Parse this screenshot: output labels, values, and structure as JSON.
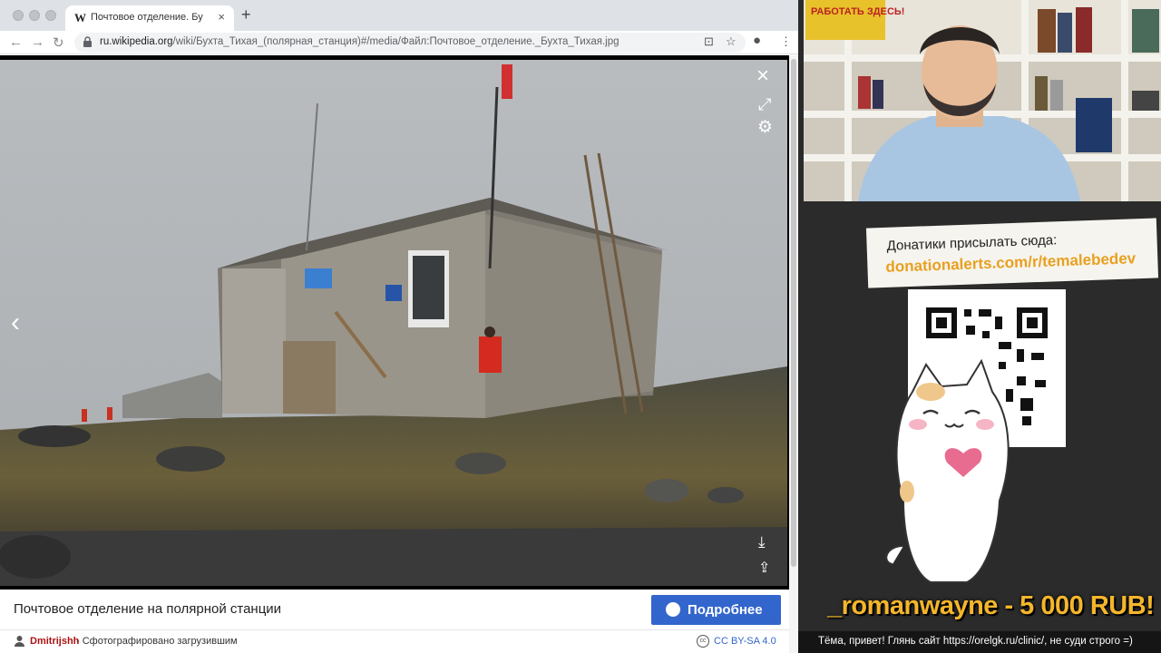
{
  "browser": {
    "tab_title": "Почтовое отделение. Бухта Т",
    "tab_favicon": "W",
    "url_host": "ru.wikipedia.org",
    "url_path": "/wiki/Бухта_Тихая_(полярная_станция)#/media/Файл:Почтовое_отделение._Бухта_Тихая.jpg"
  },
  "viewer": {
    "caption": "Почтовое отделение на полярной станции",
    "more_button": "Подробнее",
    "author": "Dmitrijshh",
    "author_desc": "- Сфотографировано загрузившим",
    "license": "CC BY-SA 4.0",
    "icons": [
      "close-icon",
      "fullscreen-icon",
      "settings-icon",
      "prev-arrow-icon",
      "download-icon",
      "share-icon"
    ]
  },
  "stream": {
    "poster_text": "РАБОТАТЬ ЗДЕСЬ!",
    "donate_label": "Донатики присылать сюда:",
    "donate_url": "donationalerts.com/r/temalebedev",
    "alert_text": "_romanwayne - 5 000 RUB!",
    "chat_message": "Тёма, привет! Глянь сайт https://orelgk.ru/clinic/, не суди строго =)"
  },
  "colors": {
    "accent": "#3366cc",
    "alert": "#f5b62b",
    "donate_url": "#e8a020"
  }
}
